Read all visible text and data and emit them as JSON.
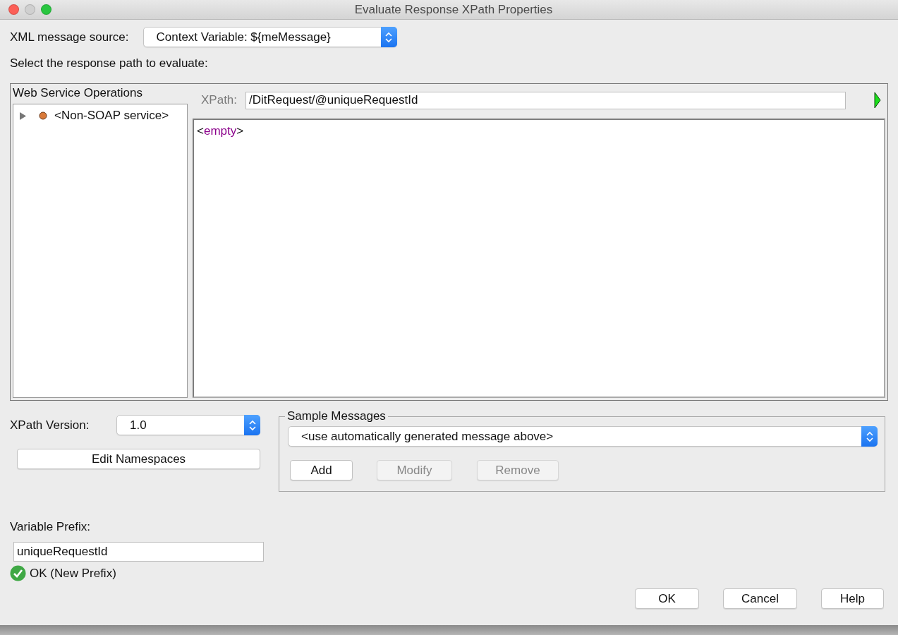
{
  "window": {
    "title": "Evaluate Response XPath Properties"
  },
  "message_source": {
    "label": "XML message source:",
    "value": "Context Variable: ${meMessage}"
  },
  "instruction": "Select the response path to evaluate:",
  "operations": {
    "title": "Web Service Operations",
    "items": [
      {
        "label": "<Non-SOAP service>",
        "expanded": false
      }
    ]
  },
  "xpath": {
    "label": "XPath:",
    "value": "/DitRequest/@uniqueRequestId"
  },
  "result": {
    "open": "<",
    "word": "empty",
    "close": ">"
  },
  "xpath_version": {
    "label": "XPath Version:",
    "value": "1.0"
  },
  "edit_namespaces": {
    "label": "Edit Namespaces",
    "disabled": false
  },
  "sample_messages": {
    "title": "Sample Messages",
    "value": "<use automatically generated message above>",
    "buttons": [
      {
        "label": "Add",
        "disabled": false
      },
      {
        "label": "Modify",
        "disabled": true
      },
      {
        "label": "Remove",
        "disabled": true
      }
    ]
  },
  "variable_prefix": {
    "label": "Variable Prefix:",
    "value": "uniqueRequestId",
    "status": "OK (New Prefix)",
    "valid": true
  },
  "buttons": [
    {
      "label": "OK"
    },
    {
      "label": "Cancel"
    },
    {
      "label": "Help"
    }
  ]
}
